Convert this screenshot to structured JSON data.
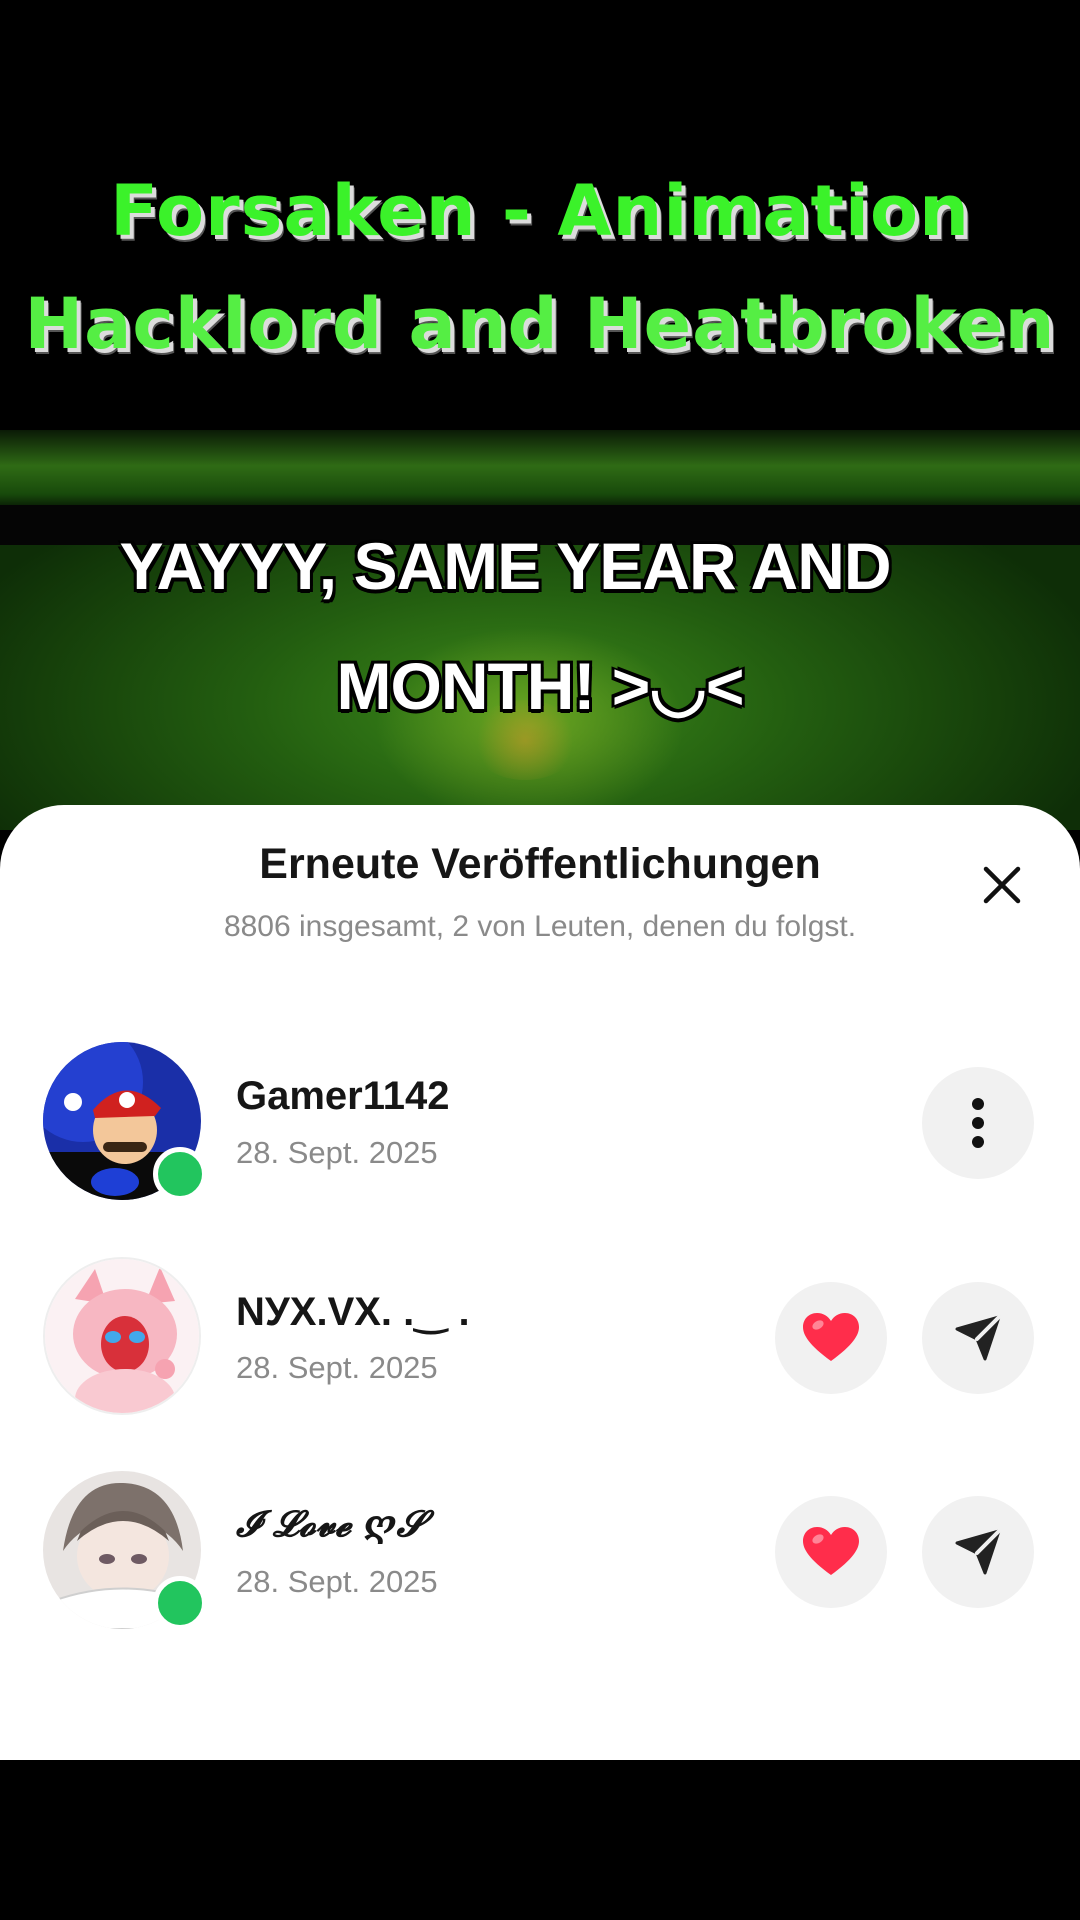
{
  "video": {
    "title_line1": "Forsaken - Animation",
    "title_line2": "Hacklord and Heatbroken",
    "caption_line1": "YAYYY, SAME YEAR AND",
    "caption_line2": "MONTH! >◡<"
  },
  "sheet": {
    "title": "Erneute Veröffentlichungen",
    "subtitle": "8806 insgesamt, 2 von Leuten, denen du folgst.",
    "close_icon": "close-icon"
  },
  "reposts": [
    {
      "username": "Gamer1142",
      "date": "28. Sept. 2025",
      "online": true,
      "action_icons": [
        "more-vertical-icon"
      ]
    },
    {
      "username": "NУX.VX. .‿ .",
      "date": "28. Sept. 2025",
      "online": false,
      "action_icons": [
        "heart-icon",
        "send-icon"
      ]
    },
    {
      "username": "𝓘 𝓛𝓸𝓿𝓮 ღ𝓢",
      "date": "28. Sept. 2025",
      "online": true,
      "action_icons": [
        "heart-icon",
        "send-icon"
      ]
    }
  ],
  "colors": {
    "title_green": "#3bf22a",
    "online_green": "#22c55e",
    "heart_red": "#ff2d4b",
    "button_bg": "#f1f1f1"
  }
}
